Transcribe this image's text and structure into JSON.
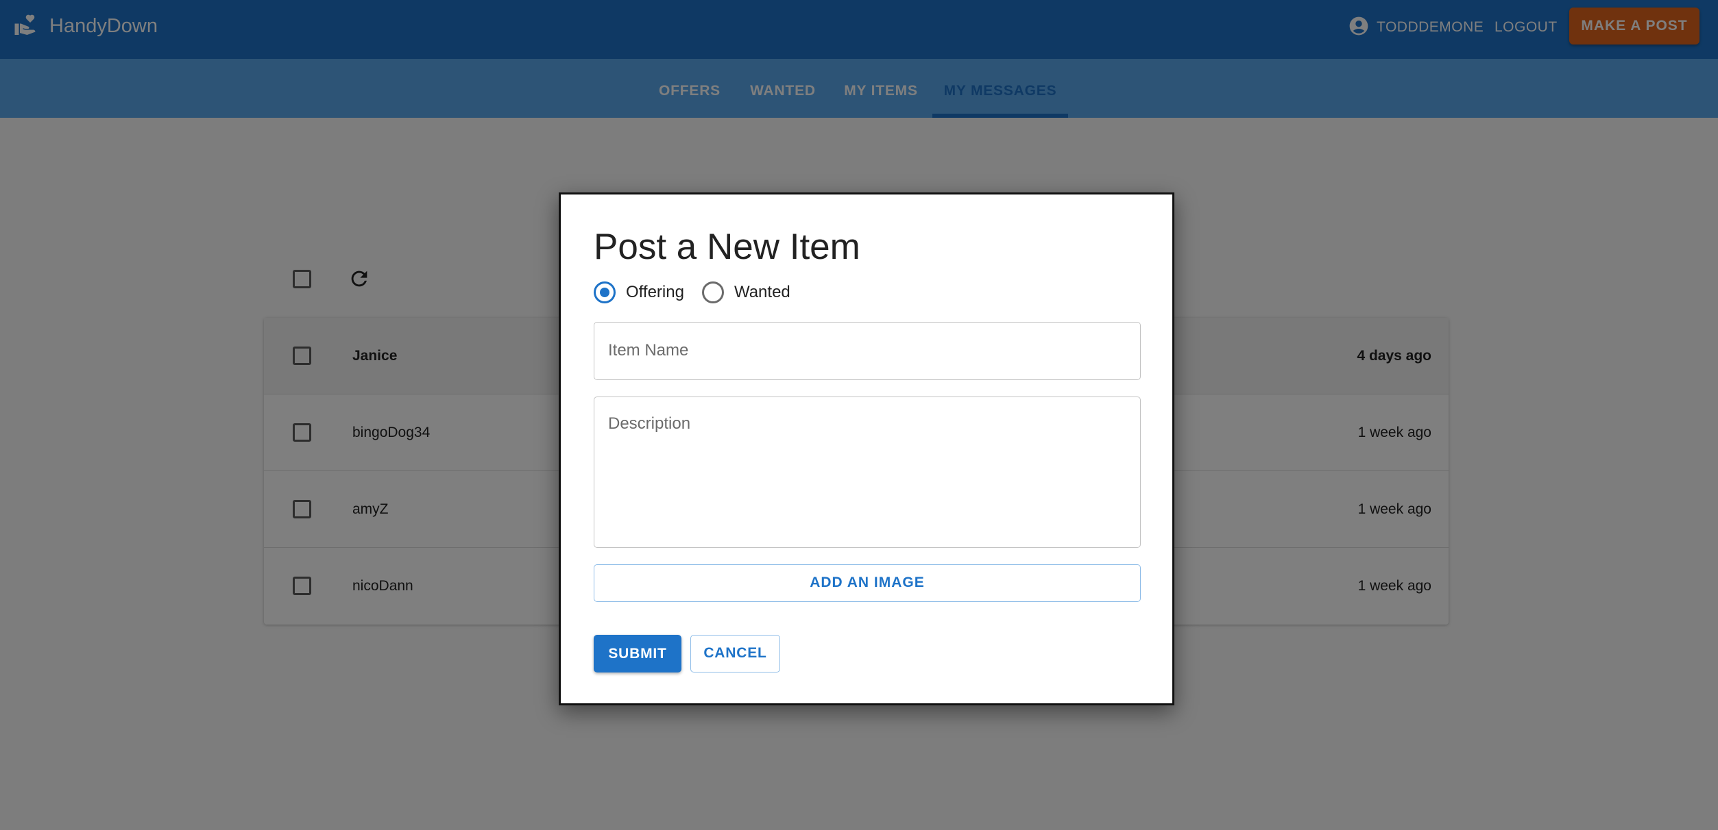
{
  "app": {
    "brand_name": "HandyDown",
    "brand_icon": "volunteer-hand-heart-icon",
    "account_icon": "account-circle-icon",
    "username": "TODDDEMONE",
    "logout_label": "LOGOUT",
    "make_post_label": "MAKE A POST",
    "colors": {
      "primary": "#1e73c8",
      "tab_bar": "#5ba9ec",
      "accent": "#e0641c"
    }
  },
  "tabs": [
    {
      "label": "OFFERS"
    },
    {
      "label": "WANTED"
    },
    {
      "label": "MY ITEMS"
    },
    {
      "label": "MY MESSAGES",
      "active": true
    }
  ],
  "messages": {
    "refresh_icon": "refresh-icon",
    "rows": [
      {
        "sender": "Janice",
        "time": "4 days ago",
        "unread": true
      },
      {
        "sender": "bingoDog34",
        "time": "1 week ago",
        "unread": false
      },
      {
        "sender": "amyZ",
        "time": "1 week ago",
        "unread": false
      },
      {
        "sender": "nicoDann",
        "time": "1 week ago",
        "unread": false
      }
    ]
  },
  "dialog": {
    "title": "Post a New Item",
    "post_type": {
      "options": [
        "Offering",
        "Wanted"
      ],
      "selected": "Offering"
    },
    "item_name": {
      "value": "",
      "placeholder": "Item Name"
    },
    "description": {
      "value": "",
      "placeholder": "Description"
    },
    "add_image_label": "ADD AN IMAGE",
    "submit_label": "SUBMIT",
    "cancel_label": "CANCEL"
  }
}
